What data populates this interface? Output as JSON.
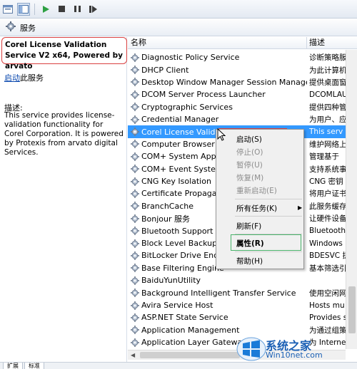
{
  "toolbar": {
    "icons": [
      "console-icon",
      "window-icon",
      "play-icon",
      "stop-icon",
      "pause-icon",
      "resume-icon"
    ]
  },
  "header": {
    "title": "服务"
  },
  "left_pane": {
    "title": "Corel License Validation Service V2 x64, Powered by arvato",
    "start_link": "启动",
    "start_suffix": "此服务",
    "desc_label": "描述:",
    "description": "This service provides license-validation functionality for Corel Corporation. It is powered by Protexis from arvato digital Services."
  },
  "list": {
    "columns": {
      "name": "名称",
      "desc": "描述"
    },
    "rows": [
      {
        "name": "Diagnostic Policy Service",
        "desc": "诊断策略服"
      },
      {
        "name": "DHCP Client",
        "desc": "为此计算机"
      },
      {
        "name": "Desktop Window Manager Session Manager",
        "desc": "提供桌面窗"
      },
      {
        "name": "DCOM Server Process Launcher",
        "desc": "DCOMLAU"
      },
      {
        "name": "Cryptographic Services",
        "desc": "提供四种管"
      },
      {
        "name": "Credential Manager",
        "desc": "为用户、应"
      },
      {
        "name": "Corel License Validatio",
        "desc": "This serv"
      },
      {
        "name": "Computer Browser",
        "desc": "维护网络上"
      },
      {
        "name": "COM+ System Applica",
        "desc": "管理基于"
      },
      {
        "name": "COM+ Event System",
        "desc": "支持系统事"
      },
      {
        "name": "CNG Key Isolation",
        "desc": "CNG 密钥"
      },
      {
        "name": "Certificate Propagatio",
        "desc": "将用户证书"
      },
      {
        "name": "BranchCache",
        "desc": "此服务缓存"
      },
      {
        "name": "Bonjour 服务",
        "desc": "让硬件设备"
      },
      {
        "name": "Bluetooth Support Ser",
        "desc": "Bluetooth"
      },
      {
        "name": "Block Level Backup En",
        "desc": "Windows"
      },
      {
        "name": "BitLocker Drive Encryp",
        "desc": "BDESVC 提"
      },
      {
        "name": "Base Filtering Engine",
        "desc": "基本筛选引"
      },
      {
        "name": "BaiduYunUtility",
        "desc": ""
      },
      {
        "name": "Background Intelligent Transfer Service",
        "desc": "使用空闲网"
      },
      {
        "name": "Avira Service Host",
        "desc": "Hosts mu"
      },
      {
        "name": "ASP.NET State Service",
        "desc": "Provides s"
      },
      {
        "name": "Application Management",
        "desc": "为通过组策"
      },
      {
        "name": "Application Layer Gateway S",
        "desc": "为 Interne"
      }
    ]
  },
  "context_menu": {
    "start": "启动(S)",
    "stop": "停止(O)",
    "pause": "暂停(U)",
    "resume": "恢复(M)",
    "restart": "重新启动(E)",
    "all_tasks": "所有任务(K)",
    "refresh": "刷新(F)",
    "properties": "属性(R)",
    "help": "帮助(H)"
  },
  "tabs": [
    "扩展",
    "标准"
  ],
  "watermark": {
    "cn": "系统之家",
    "en": "Win10net.com"
  }
}
